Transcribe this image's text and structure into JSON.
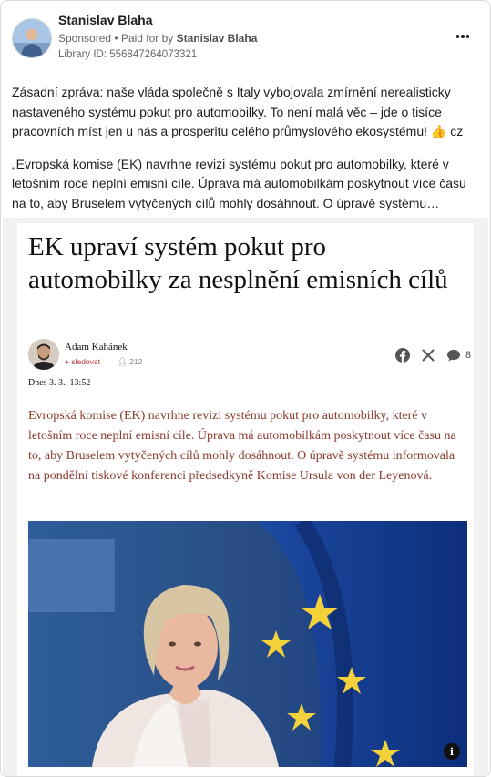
{
  "post": {
    "author": "Stanislav Blaha",
    "sponsored": "Sponsored",
    "separator": "•",
    "paid_for_by": "Paid for by",
    "payer": "Stanislav Blaha",
    "library_id": "Library ID: 556847264073321",
    "more_icon": "more-horizontal-icon",
    "text_paragraph_1": "Zásadní zpráva: naše vláda společně s Italy vybojovala zmírnění nerealisticky nastaveného systému pokut pro automobilky. To není malá věc – jde o tisíce pracovních míst jen u nás a prosperitu celého průmyslového ekosystému! 👍 cz",
    "text_paragraph_2": "„Evropská komise (EK) navrhne revizi systému pokut pro automobilky, které v letošním roce neplní emisní cíle. Úprava má automobilkám poskytnout více času na to, aby Bruselem vytyčených cílů mohly dosáhnout. O úpravě systému…"
  },
  "article": {
    "headline": "EK upraví systém pokut pro automobilky za nesplnění emisních cílů",
    "author_name": "Adam Kahánek",
    "follow_label": "+ sledovat",
    "followers": "212",
    "comments_count": "8",
    "date": "Dnes 3. 3., 13:52",
    "lead": "Evropská komise (EK) navrhne revizi systému pokut pro automobilky, které v letošním roce neplní emisní cíle. Úprava má automobilkám poskytnout více času na to, aby Bruselem vytyčených cílů mohly dosáhnout. O úpravě systému informovala na pondělní tiskové konferenci předsedkyně Komise Ursula von der Leyenová.",
    "info_label": "i",
    "share_icons": [
      "facebook-icon",
      "x-icon",
      "comment-icon"
    ]
  },
  "colors": {
    "lead_text": "#8a3a2e",
    "follow_link": "#b4303b",
    "eu_blue": "#1f4fa8",
    "eu_star": "#f2d13a"
  }
}
